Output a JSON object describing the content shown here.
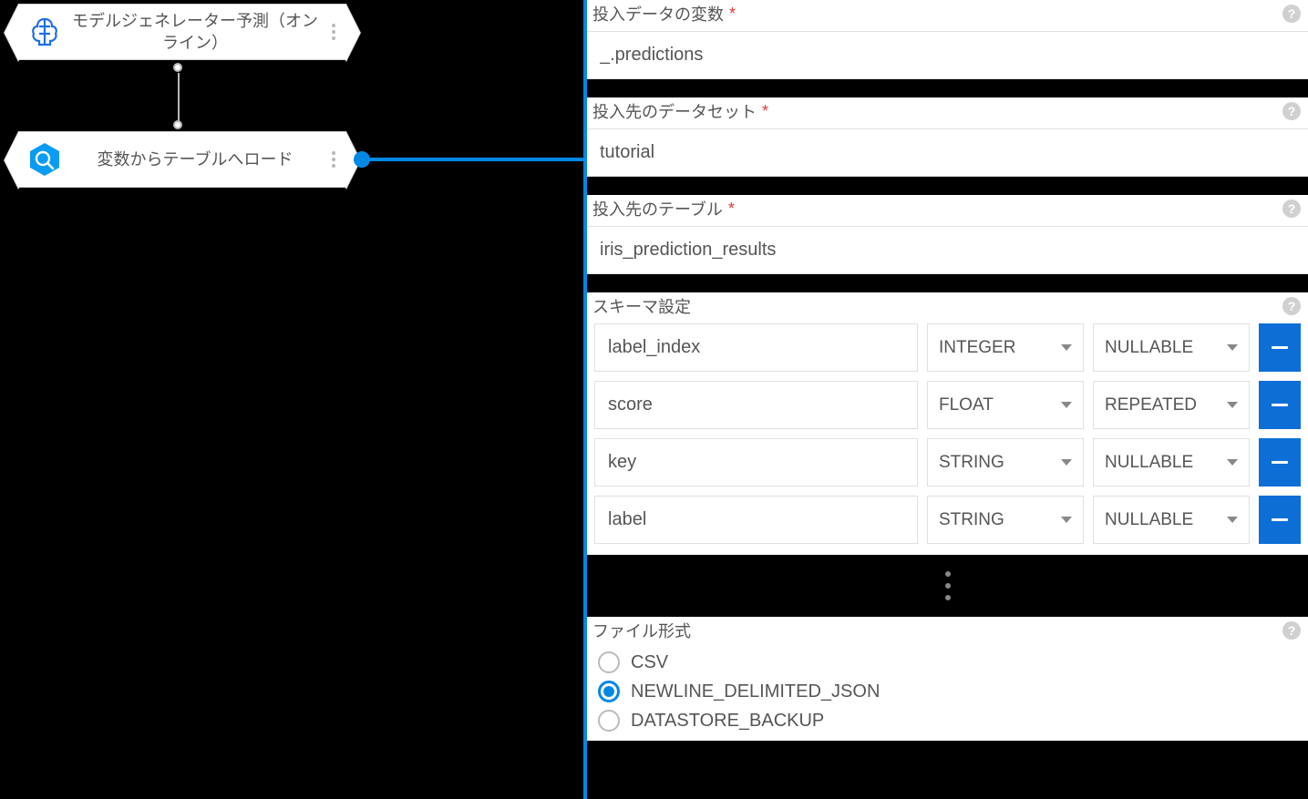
{
  "canvas": {
    "node1": {
      "label": "モデルジェネレーター予測（オンライン）"
    },
    "node2": {
      "label": "変数からテーブルへロード"
    }
  },
  "panel": {
    "field_input_var": {
      "label": "投入データの変数",
      "required": "*",
      "value": "_.predictions"
    },
    "field_dataset": {
      "label": "投入先のデータセット",
      "required": "*",
      "value": "tutorial"
    },
    "field_table": {
      "label": "投入先のテーブル",
      "required": "*",
      "value": "iris_prediction_results"
    },
    "schema": {
      "label": "スキーマ設定",
      "rows": [
        {
          "name": "label_index",
          "type": "INTEGER",
          "mode": "NULLABLE"
        },
        {
          "name": "score",
          "type": "FLOAT",
          "mode": "REPEATED"
        },
        {
          "name": "key",
          "type": "STRING",
          "mode": "NULLABLE"
        },
        {
          "name": "label",
          "type": "STRING",
          "mode": "NULLABLE"
        }
      ]
    },
    "file_format": {
      "label": "ファイル形式",
      "options": [
        {
          "label": "CSV",
          "selected": false
        },
        {
          "label": "NEWLINE_DELIMITED_JSON",
          "selected": true
        },
        {
          "label": "DATASTORE_BACKUP",
          "selected": false
        }
      ]
    }
  },
  "help": "?"
}
